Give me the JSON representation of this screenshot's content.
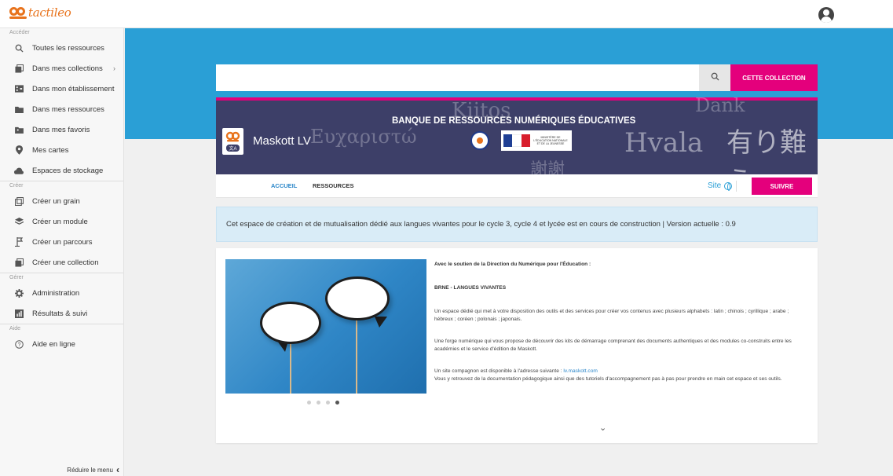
{
  "app": {
    "logo_text": "tactileo"
  },
  "sidebar": {
    "sections": [
      {
        "label": "Accéder",
        "items": [
          {
            "label": "Toutes les ressources",
            "icon": "search-icon"
          },
          {
            "label": "Dans mes collections",
            "icon": "collection-icon",
            "has_submenu": true
          },
          {
            "label": "Dans mon établissement",
            "icon": "building-icon"
          },
          {
            "label": "Dans mes ressources",
            "icon": "folder-icon"
          },
          {
            "label": "Dans mes favoris",
            "icon": "favorites-icon"
          },
          {
            "label": "Mes cartes",
            "icon": "map-pin-icon"
          },
          {
            "label": "Espaces de stockage",
            "icon": "cloud-icon"
          }
        ]
      },
      {
        "label": "Créer",
        "items": [
          {
            "label": "Créer un grain",
            "icon": "grain-icon"
          },
          {
            "label": "Créer un module",
            "icon": "module-icon"
          },
          {
            "label": "Créer un parcours",
            "icon": "path-icon"
          },
          {
            "label": "Créer une collection",
            "icon": "collection-icon"
          }
        ]
      },
      {
        "label": "Gérer",
        "items": [
          {
            "label": "Administration",
            "icon": "gear-icon"
          },
          {
            "label": "Résultats & suivi",
            "icon": "results-icon"
          }
        ]
      },
      {
        "label": "Aide",
        "items": [
          {
            "label": "Aide en ligne",
            "icon": "help-icon"
          }
        ]
      }
    ],
    "reduce_label": "Réduire le menu"
  },
  "search": {
    "value": "",
    "placeholder": "",
    "collection_button": "CETTE COLLECTION"
  },
  "header": {
    "title": "BANQUE DE RESSOURCES NUMÉRIQUES ÉDUCATIVES",
    "brand_name": "Maskott LV",
    "ministry_text": "MINISTÈRE DE L'ÉDUCATION NATIONALE ET DE LA JEUNESSE",
    "background_words": [
      "Kiitos",
      "Ευχαριστώ",
      "Hvala",
      "有り難う",
      "謝謝",
      "Dank"
    ]
  },
  "nav": {
    "tabs": [
      "ACCUEIL",
      "RESSOURCES"
    ],
    "active_tab": "ACCUEIL",
    "site_label": "Site",
    "follow_button": "SUIVRE"
  },
  "info": {
    "message": "Cet espace de création et de mutualisation dédié aux langues vivantes pour le cycle 3, cycle 4 et lycée est en cours de construction | Version actuelle : 0.9"
  },
  "content": {
    "support_title": "Avec le soutien de la Direction du Numérique pour l'Éducation :",
    "section_title": "BRNE - LANGUES VIVANTES",
    "para1": "Un espace dédié qui met à votre disposition des outils et des services pour créer vos contenus avec plusieurs alphabets : latin ; chinois ; cyrillique ; arabe ; hébreux ; coréen ; polonais ; japonais.",
    "para2": "Une forge numérique qui vous propose de découvrir des kits de démarrage comprenant des documents authentiques et des modules co-construits entre les académies et le service d'édition de Maskott.",
    "para3_prefix": "Un site compagnon est disponible à l'adresse suivante :",
    "para3_link": "lv.maskott.com",
    "para4": "Vous y retrouvez de la documentation pédagogique ainsi que des tutoriels d'accompagnement pas à pas pour prendre en main cet espace et ses outils.",
    "carousel": {
      "count": 4,
      "active_index": 3
    }
  },
  "colors": {
    "accent_pink": "#e4007c",
    "banner_blue": "#2a9fd6",
    "header_navy": "#3d3f68",
    "logo_orange": "#e8731c"
  }
}
